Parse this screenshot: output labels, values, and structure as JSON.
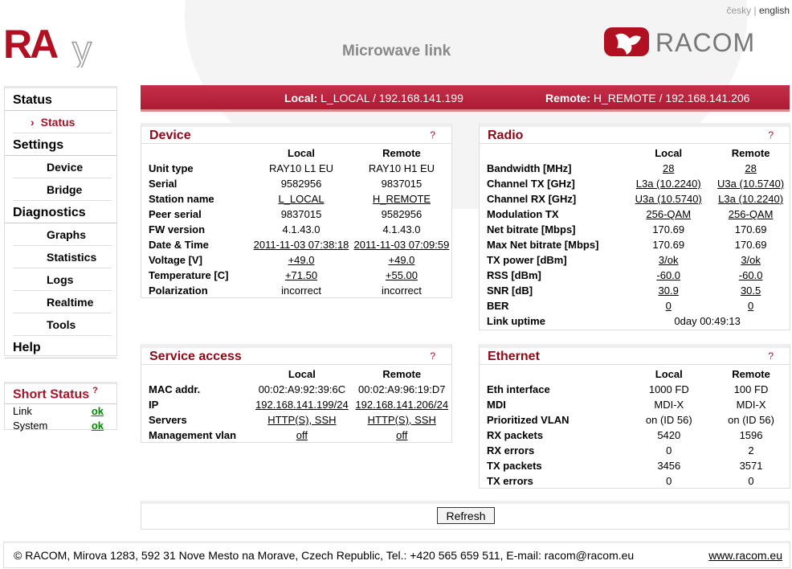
{
  "lang": {
    "cz": "česky",
    "sep": "|",
    "en": "english"
  },
  "logo_ray": "RAy",
  "logo_racom": "RACOM",
  "title": "Microwave link",
  "colors": {
    "accent": "#ad1a34",
    "ok": "#008800"
  },
  "sidebar": {
    "sections": [
      {
        "label": "Status",
        "items": [
          {
            "label": "Status",
            "active": true
          }
        ]
      },
      {
        "label": "Settings",
        "items": [
          {
            "label": "Device"
          },
          {
            "label": "Bridge"
          }
        ]
      },
      {
        "label": "Diagnostics",
        "items": [
          {
            "label": "Graphs"
          },
          {
            "label": "Statistics"
          },
          {
            "label": "Logs"
          },
          {
            "label": "Realtime"
          },
          {
            "label": "Tools"
          }
        ]
      },
      {
        "label": "Help",
        "items": []
      }
    ]
  },
  "short_status": {
    "title": "Short Status",
    "help": "?",
    "rows": [
      {
        "label": "Link",
        "value": "ok"
      },
      {
        "label": "System",
        "value": "ok"
      }
    ]
  },
  "header": {
    "local_label": "Local:",
    "local_value": "L_LOCAL / 192.168.141.199",
    "remote_label": "Remote:",
    "remote_value": "H_REMOTE / 192.168.141.206"
  },
  "cols": {
    "local": "Local",
    "remote": "Remote"
  },
  "panels": {
    "device": {
      "title": "Device",
      "help": "?",
      "rows": [
        [
          "Unit type",
          "RAY10 L1 EU",
          "RAY10 H1 EU",
          0
        ],
        [
          "Serial",
          "9582956",
          "9837015",
          0
        ],
        [
          "Station name",
          "L_LOCAL",
          "H_REMOTE",
          1
        ],
        [
          "Peer serial",
          "9837015",
          "9582956",
          0
        ],
        [
          "FW version",
          "4.1.43.0",
          "4.1.43.0",
          0
        ],
        [
          "Date & Time",
          "2011-11-03 07:38:18",
          "2011-11-03 07:09:59",
          1
        ],
        [
          "Voltage [V]",
          "+49.0",
          "+49.0",
          1
        ],
        [
          "Temperature [C]",
          "+71.50",
          "+55.00",
          1
        ],
        [
          "Polarization",
          "incorrect",
          "incorrect",
          0
        ]
      ]
    },
    "service": {
      "title": "Service access",
      "help": "?",
      "rows": [
        [
          "MAC addr.",
          "00:02:A9:92:39:6C",
          "00:02:A9:96:19:D7",
          0
        ],
        [
          "IP",
          "192.168.141.199/24",
          "192.168.141.206/24",
          1
        ],
        [
          "Servers",
          "HTTP(S), SSH",
          "HTTP(S), SSH",
          1
        ],
        [
          "Management vlan",
          "off",
          "off",
          1
        ]
      ]
    },
    "radio": {
      "title": "Radio",
      "help": "?",
      "rows": [
        [
          "Bandwidth [MHz]",
          "28",
          "28",
          1
        ],
        [
          "Channel TX [GHz]",
          "L3a (10.2240)",
          "U3a (10.5740)",
          1
        ],
        [
          "Channel RX [GHz]",
          "U3a (10.5740)",
          "L3a (10.2240)",
          1
        ],
        [
          "Modulation TX",
          "256-QAM",
          "256-QAM",
          1
        ],
        [
          "Net bitrate [Mbps]",
          "170.69",
          "170.69",
          0
        ],
        [
          "Max Net bitrate [Mbps]",
          "170.69",
          "170.69",
          0
        ],
        [
          "TX power [dBm]",
          "3/ok",
          "3/ok",
          1
        ],
        [
          "RSS [dBm]",
          "-60.0",
          "-60.0",
          1
        ],
        [
          "SNR [dB]",
          "30.9",
          "30.5",
          1
        ],
        [
          "BER",
          "0",
          "0",
          1
        ]
      ],
      "uptime_label": "Link uptime",
      "uptime": "0day 00:49:13"
    },
    "ethernet": {
      "title": "Ethernet",
      "help": "?",
      "rows": [
        [
          "Eth interface",
          "1000 FD",
          "100 FD",
          0
        ],
        [
          "MDI",
          "MDI-X",
          "MDI-X",
          0
        ],
        [
          "Prioritized VLAN",
          "on (ID 56)",
          "on (ID 56)",
          0
        ],
        [
          "RX packets",
          "5420",
          "1596",
          0
        ],
        [
          "RX errors",
          "0",
          "2",
          0
        ],
        [
          "TX packets",
          "3456",
          "3571",
          0
        ],
        [
          "TX errors",
          "0",
          "0",
          0
        ]
      ]
    }
  },
  "refresh": "Refresh",
  "footer": {
    "text": "© RACOM, Mirova 1283, 592 31 Nove Mesto na Morave, Czech Republic, Tel.: +420 565 659 511, E-mail: racom@racom.eu",
    "link": "www.racom.eu"
  }
}
